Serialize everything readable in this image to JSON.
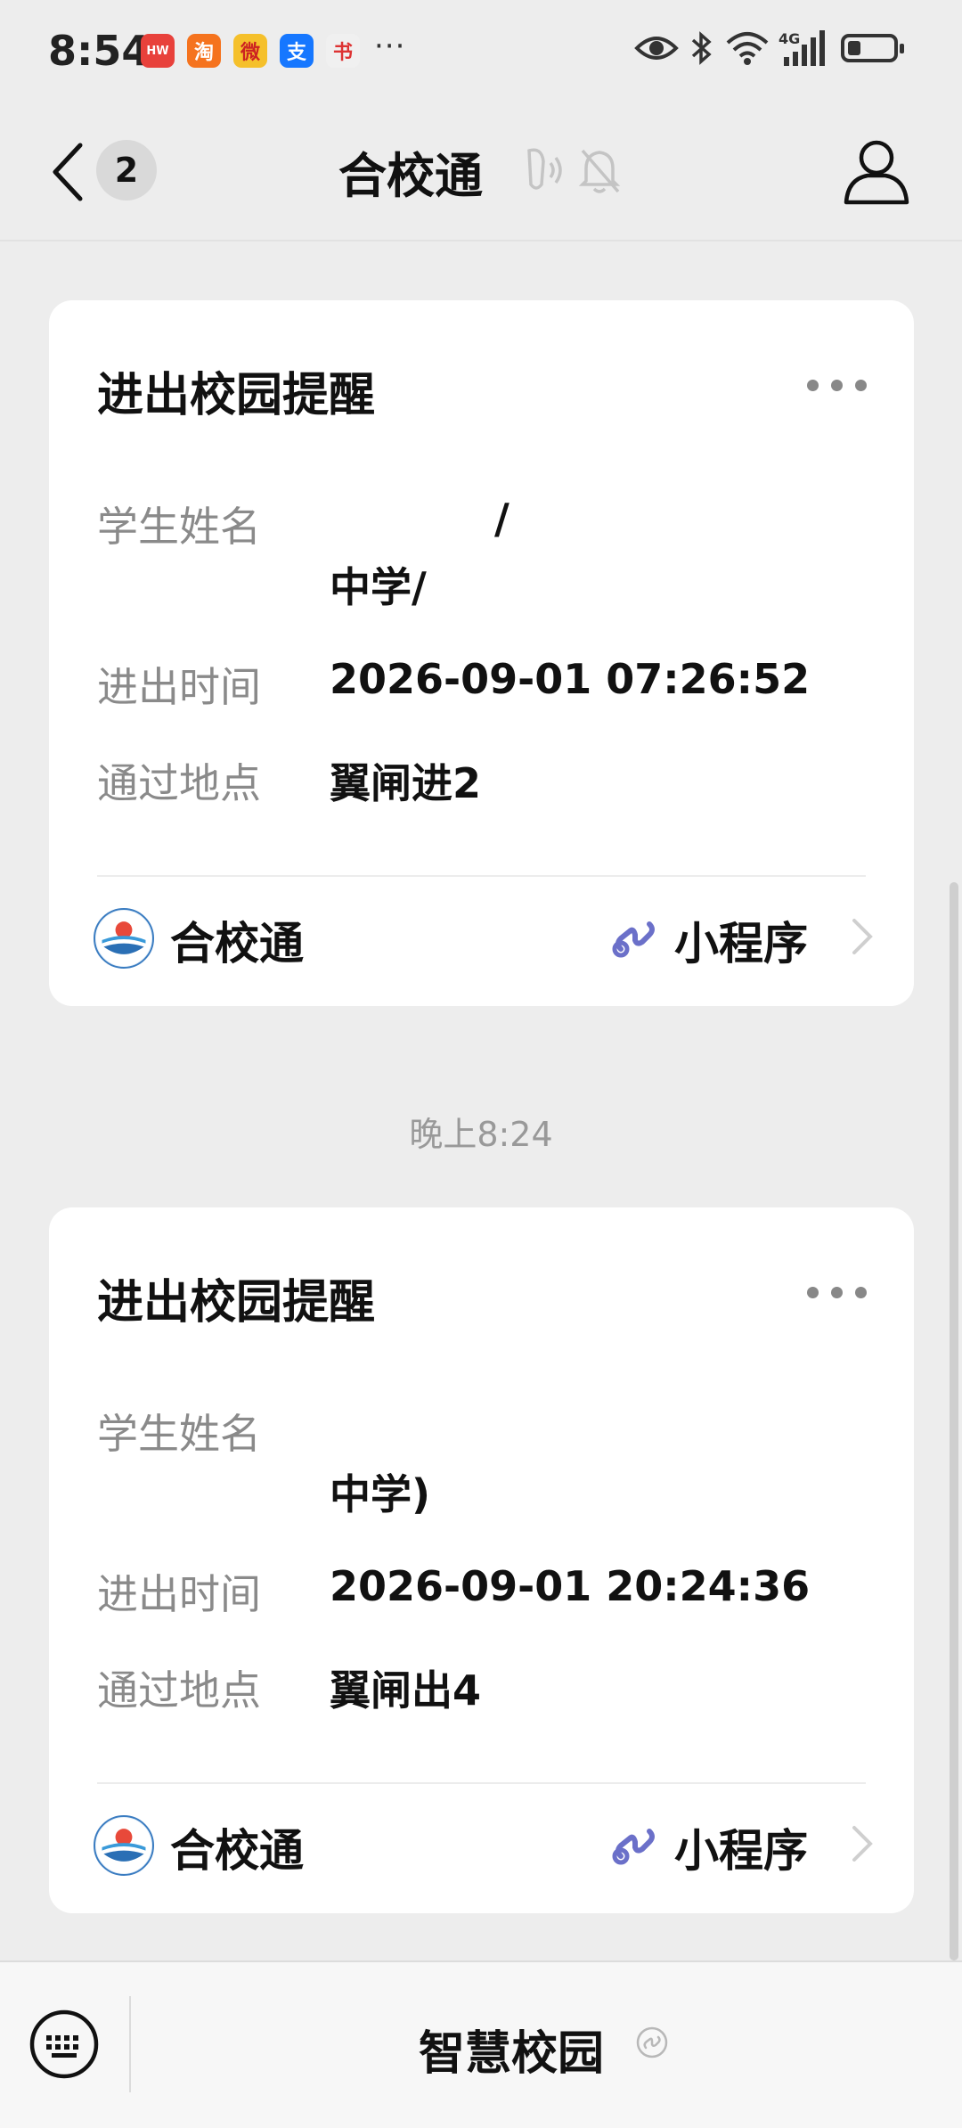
{
  "status_bar": {
    "time": "8:54",
    "app_icons": [
      {
        "name": "huawei-appgallery-icon",
        "glyph": "HW",
        "color": "#e8413b"
      },
      {
        "name": "taobao-icon",
        "glyph": "淘",
        "color": "#f5731e"
      },
      {
        "name": "weibo-icon",
        "glyph": "微",
        "color": "#f5c02b"
      },
      {
        "name": "alipay-icon",
        "glyph": "支",
        "color": "#1677ff"
      },
      {
        "name": "book-reader-icon",
        "glyph": "书",
        "color": "#f0f0f0"
      }
    ],
    "more": "···",
    "network": "4G"
  },
  "nav": {
    "unread_count": "2",
    "title": "合校通"
  },
  "messages": [
    {
      "card_title": "进出校园提醒",
      "student_label": "学生姓名",
      "student_value_line1": "/",
      "student_value_line2": "中学/",
      "time_label": "进出时间",
      "time_value": "2026-09-01 07:26:52",
      "place_label": "通过地点",
      "place_value": "翼闸进2",
      "app_name": "合校通",
      "mini_program_label": "小程序"
    },
    {
      "card_title": "进出校园提醒",
      "student_label": "学生姓名",
      "student_value_line1": "",
      "student_value_line2": "中学)",
      "time_label": "进出时间",
      "time_value": "2026-09-01 20:24:36",
      "place_label": "通过地点",
      "place_value": "翼闸出4",
      "app_name": "合校通",
      "mini_program_label": "小程序"
    }
  ],
  "timestamp_divider": "晚上8:24",
  "bottom_bar": {
    "menu_label": "智慧校园"
  },
  "colors": {
    "background": "#ededed",
    "card": "#ffffff",
    "label_gray": "#8a8a8a",
    "mini_program_purple": "#6b70c9"
  }
}
